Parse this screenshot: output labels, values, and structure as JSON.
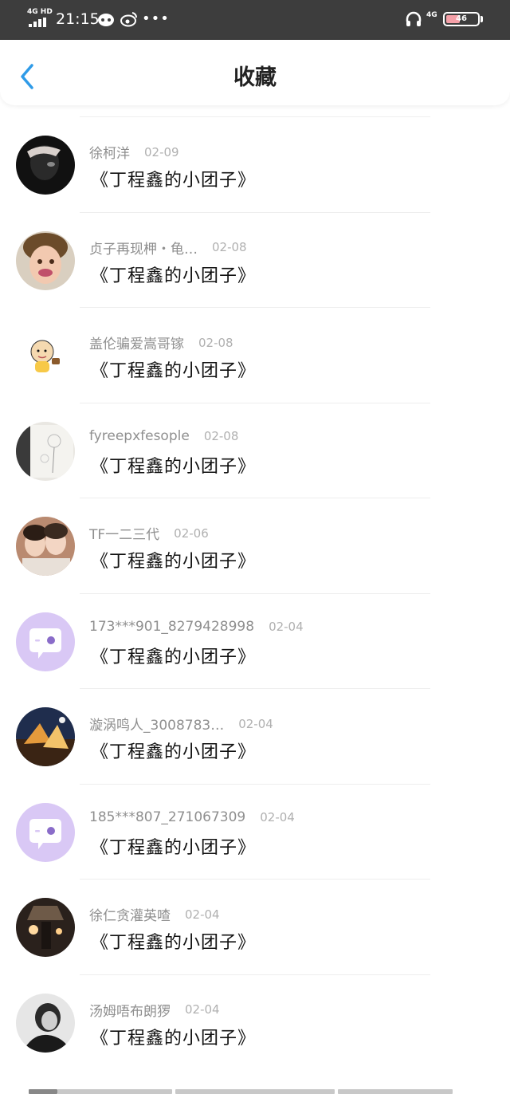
{
  "status_bar": {
    "network": "4G HD",
    "time": "21:15",
    "cell": "4G",
    "battery": "46",
    "battery_level": 0.46
  },
  "nav": {
    "title": "收藏"
  },
  "items": [
    {
      "name": "徐柯洋",
      "date": "02-09",
      "title": "《丁程鑫的小团子》",
      "avatar": "dark-photo"
    },
    {
      "name": "贞子再现柙・龟…",
      "date": "02-08",
      "title": "《丁程鑫的小团子》",
      "avatar": "child-photo"
    },
    {
      "name": "盖伦骗爱嵩哥镓",
      "date": "02-08",
      "title": "《丁程鑫的小团子》",
      "avatar": "cartoon-baby"
    },
    {
      "name": "fyreepxfesople",
      "date": "02-08",
      "title": "《丁程鑫的小团子》",
      "avatar": "dandelion-photo"
    },
    {
      "name": "TF一二三代",
      "date": "02-06",
      "title": "《丁程鑫的小团子》",
      "avatar": "group-photo"
    },
    {
      "name": "173***901_8279428998",
      "date": "02-04",
      "title": "《丁程鑫的小团子》",
      "avatar": "default-chat"
    },
    {
      "name": "漩涡鸣人_3008783…",
      "date": "02-04",
      "title": "《丁程鑫的小团子》",
      "avatar": "anime-photo"
    },
    {
      "name": "185***807_271067309",
      "date": "02-04",
      "title": "《丁程鑫的小团子》",
      "avatar": "default-chat"
    },
    {
      "name": "徐仁贪灌英喳",
      "date": "02-04",
      "title": "《丁程鑫的小团子》",
      "avatar": "lamp-photo"
    },
    {
      "name": "汤姆唔布朗猡",
      "date": "02-04",
      "title": "《丁程鑫的小团子》",
      "avatar": "bw-portrait"
    }
  ],
  "colors": {
    "accent": "#2f9be8",
    "status_bar_bg": "#3d3d3d",
    "default_avatar_bg": "#d9c8f5"
  }
}
